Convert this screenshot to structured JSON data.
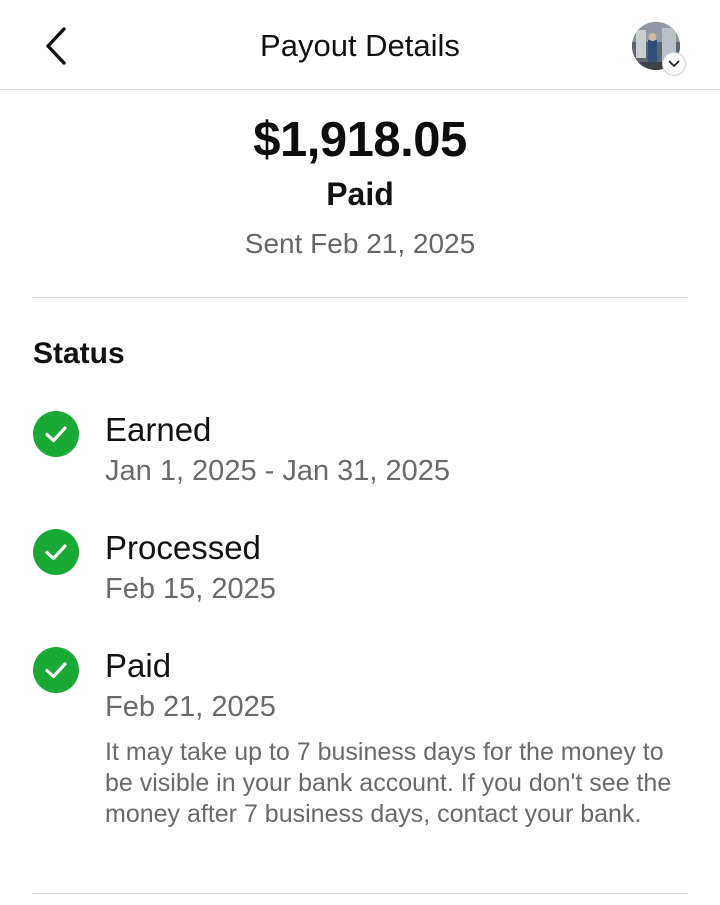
{
  "header": {
    "title": "Payout Details",
    "back_icon": "chevron-left-icon",
    "avatar_badge_icon": "chevron-down-icon"
  },
  "summary": {
    "amount": "$1,918.05",
    "state": "Paid",
    "sent_date": "Sent Feb 21, 2025"
  },
  "status": {
    "title": "Status",
    "check_color": "#1aa934",
    "items": [
      {
        "label": "Earned",
        "date": "Jan 1, 2025 - Jan 31, 2025"
      },
      {
        "label": "Processed",
        "date": "Feb 15, 2025"
      },
      {
        "label": "Paid",
        "date": "Feb 21, 2025",
        "note": "It may take up to 7 business days for the money to be visible in your bank account. If you don't see the money after 7 business days, contact your bank."
      }
    ]
  }
}
